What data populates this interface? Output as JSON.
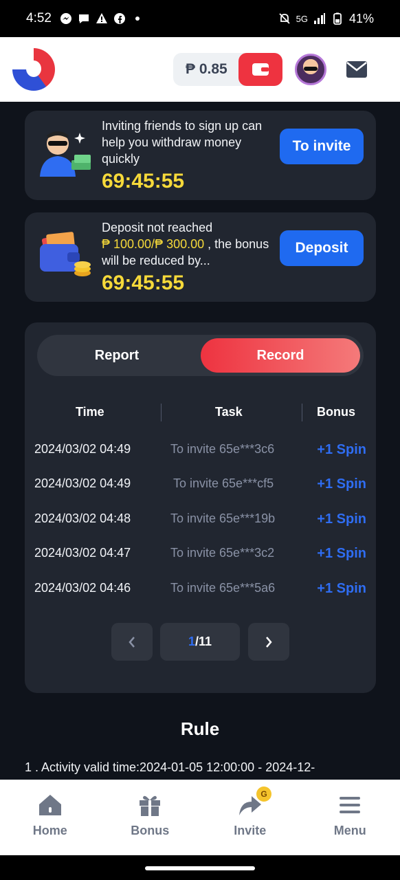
{
  "status_bar": {
    "time": "4:52",
    "network": "5G",
    "battery": "41%"
  },
  "header": {
    "balance": "₱ 0.85"
  },
  "invite_banner": {
    "text": "Inviting friends to sign up can help you withdraw money quickly",
    "timer": "69:45:55",
    "button": "To invite"
  },
  "deposit_banner": {
    "text_before": "Deposit not reached",
    "amount": "₱ 100.00/₱ 300.00",
    "text_after": " , the bonus will be reduced by...",
    "timer": "69:45:55",
    "button": "Deposit"
  },
  "tabs": {
    "report": "Report",
    "record": "Record",
    "active": "record"
  },
  "table": {
    "headers": {
      "time": "Time",
      "task": "Task",
      "bonus": "Bonus"
    },
    "rows": [
      {
        "time": "2024/03/02 04:49",
        "task": "To invite 65e***3c6",
        "bonus": "+1 Spin"
      },
      {
        "time": "2024/03/02 04:49",
        "task": "To invite 65e***cf5",
        "bonus": "+1 Spin"
      },
      {
        "time": "2024/03/02 04:48",
        "task": "To invite 65e***19b",
        "bonus": "+1 Spin"
      },
      {
        "time": "2024/03/02 04:47",
        "task": "To invite 65e***3c2",
        "bonus": "+1 Spin"
      },
      {
        "time": "2024/03/02 04:46",
        "task": "To invite 65e***5a6",
        "bonus": "+1 Spin"
      }
    ]
  },
  "pagination": {
    "current": "1",
    "total": "/11"
  },
  "rule": {
    "title": "Rule",
    "text": "1 . Activity valid time:2024-01-05 12:00:00 - 2024-12-"
  },
  "bottom_nav": [
    {
      "label": "Home",
      "icon": "home-icon"
    },
    {
      "label": "Bonus",
      "icon": "gift-icon"
    },
    {
      "label": "Invite",
      "icon": "share-icon",
      "badge": "G"
    },
    {
      "label": "Menu",
      "icon": "menu-icon"
    }
  ],
  "colors": {
    "accent_red": "#ee3340",
    "accent_blue": "#1f6af0",
    "timer_yellow": "#f6d93a",
    "bg": "#0f131b",
    "card": "#212630"
  }
}
